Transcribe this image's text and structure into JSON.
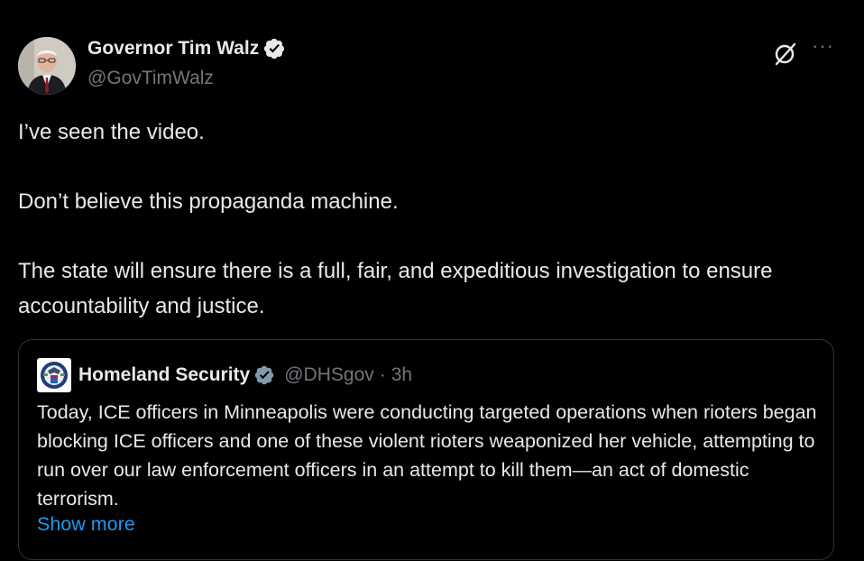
{
  "author": {
    "name": "Governor Tim Walz",
    "handle": "@GovTimWalz"
  },
  "tweet": {
    "text": "I’ve seen the video.\n\nDon’t believe this propaganda machine.\n\nThe state will ensure there is a full, fair, and expeditious investigation to ensure accountability and justice."
  },
  "quoted": {
    "name": "Homeland Security",
    "handle": "@DHSgov",
    "separator": "·",
    "time": "3h",
    "text": "Today, ICE officers in Minneapolis were conducting targeted operations when rioters began blocking ICE officers and one of these violent rioters weaponized her vehicle, attempting to run over our law enforcement officers in an attempt to kill them—an act of domestic terrorism.",
    "show_more": "Show more"
  },
  "icons": {
    "verified": "verified-badge-icon",
    "grok": "grok-icon",
    "more": "more-options-icon"
  },
  "colors": {
    "background": "#000000",
    "text": "#e7e9ea",
    "muted": "#71767b",
    "link": "#1d9bf0",
    "verified": "#1d9bf0",
    "border": "#2f3336"
  }
}
